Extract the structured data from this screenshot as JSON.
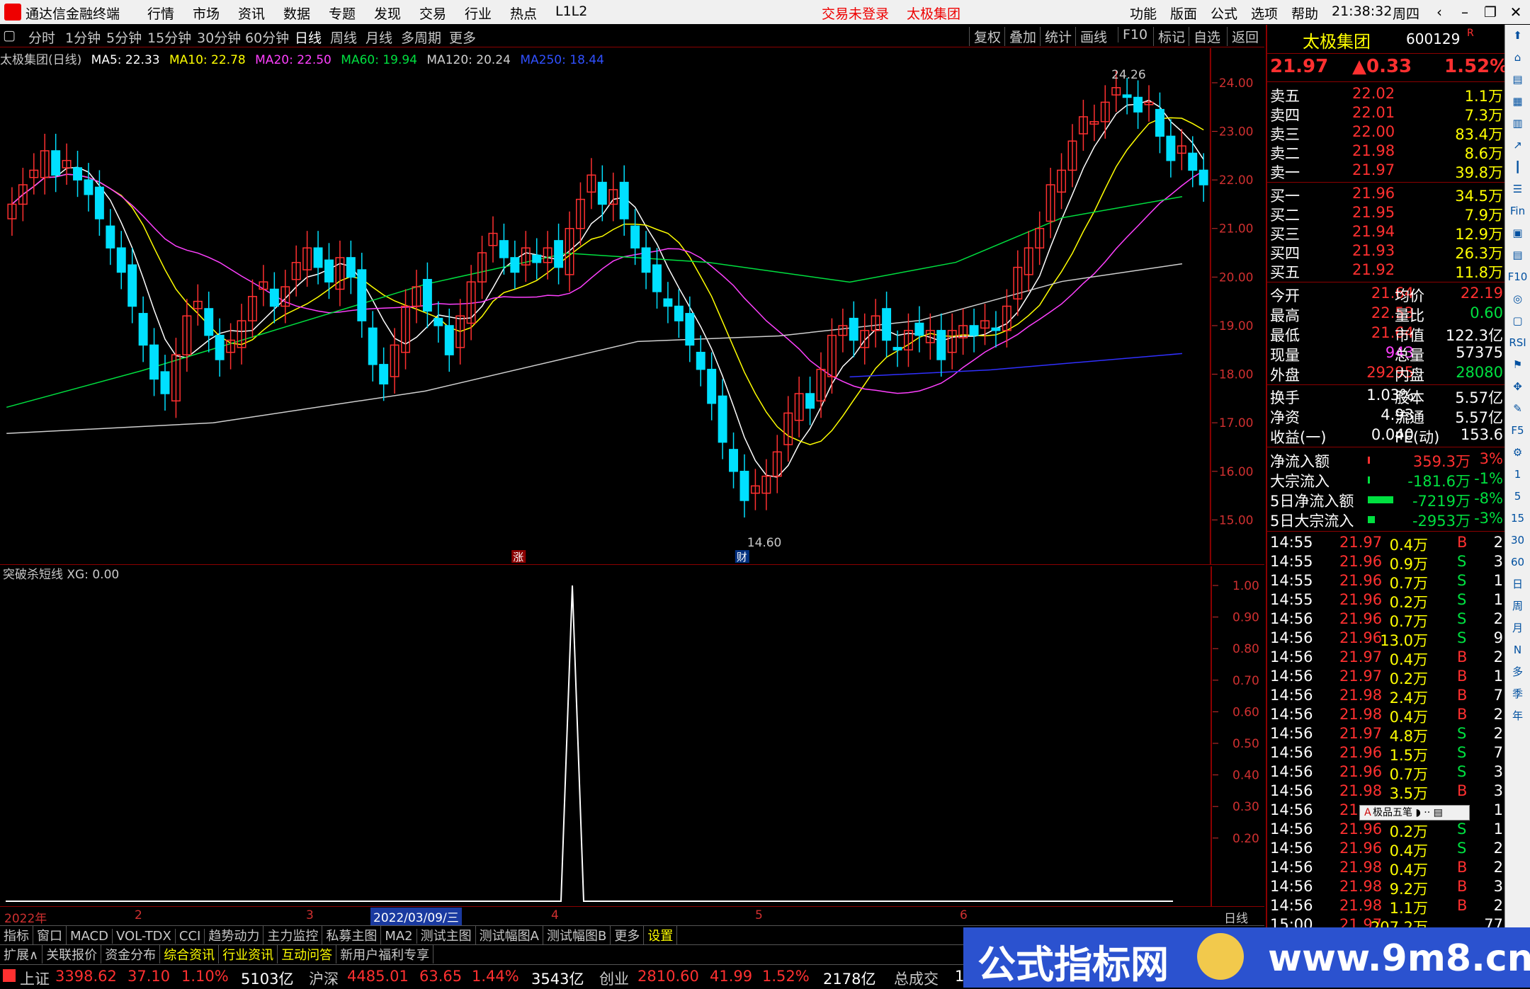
{
  "window": {
    "app_title": "通达信金融终端",
    "menus": [
      "行情",
      "市场",
      "资讯",
      "数据",
      "专题",
      "发现",
      "交易",
      "行业",
      "热点",
      "L1L2"
    ],
    "alert_login": "交易未登录",
    "alert_stock": "太极集团",
    "right_menus": [
      "功能",
      "版面",
      "公式",
      "选项",
      "帮助"
    ],
    "time": "21:38:32",
    "weekday": "周四"
  },
  "toolbar": {
    "timeframes": [
      "分时",
      "1分钟",
      "5分钟",
      "15分钟",
      "30分钟",
      "60分钟",
      "日线",
      "周线",
      "月线",
      "多周期",
      "更多"
    ],
    "buttons": [
      "复权",
      "叠加",
      "统计",
      "画线",
      "F10",
      "标记",
      "自选",
      "返回"
    ]
  },
  "legend": {
    "title": "太极集团(日线)",
    "ma5": "MA5: 22.33",
    "ma10": "MA10: 22.78",
    "ma20": "MA20: 22.50",
    "ma60": "MA60: 19.94",
    "ma120": "MA120: 20.24",
    "ma250": "MA250: 18.44"
  },
  "price_axis": [
    "24.00",
    "23.00",
    "22.00",
    "21.00",
    "20.00",
    "19.00",
    "18.00",
    "17.00",
    "16.00",
    "15.00"
  ],
  "high_label": "24.26",
  "low_label": "14.60",
  "marker_zhang": "涨",
  "marker_cai": "财",
  "indicator": {
    "title": "突破杀短线 XG: 0.00",
    "axis": [
      "1.00",
      "0.90",
      "0.80",
      "0.70",
      "0.60",
      "0.50",
      "0.40",
      "0.30",
      "0.20"
    ]
  },
  "dates": {
    "year": "2022年",
    "m2": "2",
    "m3": "3",
    "selected": "2022/03/09/三",
    "m4": "4",
    "m5": "5",
    "m6": "6",
    "period": "日线"
  },
  "tabs1": [
    "指标",
    "窗口",
    "MACD",
    "VOL-TDX",
    "CCI",
    "趋势动力",
    "主力监控",
    "私募主图",
    "MA2",
    "测试主图",
    "测试幅图A",
    "测试幅图B",
    "更多",
    "设置"
  ],
  "tabs2": [
    "扩展∧",
    "关联报价",
    "资金分布",
    "综合资讯",
    "行业资讯",
    "互动问答",
    "新用户福利专享"
  ],
  "stock": {
    "name": "太极集团",
    "code": "600129",
    "r": "R",
    "price": "21.97",
    "change": "▲0.33",
    "pct": "1.52%"
  },
  "asks": [
    {
      "label": "卖五",
      "price": "22.02",
      "vol": "1.1万"
    },
    {
      "label": "卖四",
      "price": "22.01",
      "vol": "7.3万"
    },
    {
      "label": "卖三",
      "price": "22.00",
      "vol": "83.4万"
    },
    {
      "label": "卖二",
      "price": "21.98",
      "vol": "8.6万"
    },
    {
      "label": "卖一",
      "price": "21.97",
      "vol": "39.8万"
    }
  ],
  "bids": [
    {
      "label": "买一",
      "price": "21.96",
      "vol": "34.5万"
    },
    {
      "label": "买二",
      "price": "21.95",
      "vol": "7.9万"
    },
    {
      "label": "买三",
      "price": "21.94",
      "vol": "12.9万"
    },
    {
      "label": "买四",
      "price": "21.93",
      "vol": "26.3万"
    },
    {
      "label": "买五",
      "price": "21.92",
      "vol": "11.8万"
    }
  ],
  "stats": [
    {
      "l1": "今开",
      "v1": "21.64",
      "l2": "均价",
      "v2": "22.19"
    },
    {
      "l1": "最高",
      "v1": "22.53",
      "l2": "量比",
      "v2": "0.60"
    },
    {
      "l1": "最低",
      "v1": "21.64",
      "l2": "市值",
      "v2": "122.3亿"
    },
    {
      "l1": "现量",
      "v1": "943",
      "l2": "总量",
      "v2": "57375"
    },
    {
      "l1": "外盘",
      "v1": "29295",
      "l2": "内盘",
      "v2": "28080"
    },
    {
      "l1": "换手",
      "v1": "1.03%",
      "l2": "股本",
      "v2": "5.57亿"
    },
    {
      "l1": "净资",
      "v1": "4.93",
      "l2": "流通",
      "v2": "5.57亿"
    },
    {
      "l1": "收益(一)",
      "v1": "0.040",
      "l2": "PE(动)",
      "v2": "153.6"
    }
  ],
  "flows": [
    {
      "label": "净流入额",
      "val": "359.3万",
      "pct": "3%"
    },
    {
      "label": "大宗流入",
      "val": "-181.6万",
      "pct": "-1%"
    },
    {
      "label": "5日净流入额",
      "val": "-7219万",
      "pct": "-8%"
    },
    {
      "label": "5日大宗流入",
      "val": "-2953万",
      "pct": "-3%"
    }
  ],
  "ticks": [
    {
      "t": "14:55",
      "p": "21.97",
      "v": "0.4万",
      "bs": "B",
      "n": "2"
    },
    {
      "t": "14:55",
      "p": "21.96",
      "v": "0.9万",
      "bs": "S",
      "n": "3"
    },
    {
      "t": "14:55",
      "p": "21.96",
      "v": "0.7万",
      "bs": "S",
      "n": "1"
    },
    {
      "t": "14:55",
      "p": "21.96",
      "v": "0.2万",
      "bs": "S",
      "n": "1"
    },
    {
      "t": "14:56",
      "p": "21.96",
      "v": "0.7万",
      "bs": "S",
      "n": "2"
    },
    {
      "t": "14:56",
      "p": "21.96",
      "v": "13.0万",
      "bs": "S",
      "n": "9"
    },
    {
      "t": "14:56",
      "p": "21.97",
      "v": "0.4万",
      "bs": "B",
      "n": "2"
    },
    {
      "t": "14:56",
      "p": "21.97",
      "v": "0.2万",
      "bs": "B",
      "n": "1"
    },
    {
      "t": "14:56",
      "p": "21.98",
      "v": "2.4万",
      "bs": "B",
      "n": "7"
    },
    {
      "t": "14:56",
      "p": "21.98",
      "v": "0.4万",
      "bs": "B",
      "n": "2"
    },
    {
      "t": "14:56",
      "p": "21.97",
      "v": "4.8万",
      "bs": "S",
      "n": "2"
    },
    {
      "t": "14:56",
      "p": "21.96",
      "v": "1.5万",
      "bs": "S",
      "n": "7"
    },
    {
      "t": "14:56",
      "p": "21.96",
      "v": "0.7万",
      "bs": "S",
      "n": "3"
    },
    {
      "t": "14:56",
      "p": "21.98",
      "v": "3.5万",
      "bs": "B",
      "n": "3"
    },
    {
      "t": "14:56",
      "p": "21",
      "v": "",
      "bs": "",
      "n": "1"
    },
    {
      "t": "14:56",
      "p": "21.96",
      "v": "0.2万",
      "bs": "S",
      "n": "1"
    },
    {
      "t": "14:56",
      "p": "21.96",
      "v": "0.4万",
      "bs": "S",
      "n": "2"
    },
    {
      "t": "14:56",
      "p": "21.98",
      "v": "0.4万",
      "bs": "B",
      "n": "2"
    },
    {
      "t": "14:56",
      "p": "21.98",
      "v": "9.2万",
      "bs": "B",
      "n": "3"
    },
    {
      "t": "14:56",
      "p": "21.98",
      "v": "1.1万",
      "bs": "B",
      "n": "2"
    },
    {
      "t": "15:00",
      "p": "21.97",
      "v": "207.2万",
      "bs": "",
      "n": "77"
    }
  ],
  "ime": "极品五笔",
  "status": {
    "sh_label": "上证",
    "sh_val": "3398.62",
    "sh_chg": "37.10",
    "sh_pct": "1.10%",
    "sh_amt": "5103亿",
    "hs_label": "沪深",
    "hs_val": "4485.01",
    "hs_chg": "63.65",
    "hs_pct": "1.44%",
    "hs_amt": "3543亿",
    "cy_label": "创业",
    "cy_val": "2810.60",
    "cy_chg": "41.99",
    "cy_pct": "1.52%",
    "cy_amt": "2178亿",
    "total": "总成交",
    "total_v": "1"
  },
  "watermark": {
    "text": "公式指标网",
    "url": "www.9m8.cn"
  },
  "sidebar": [
    "1",
    "5",
    "15",
    "30",
    "60",
    "日",
    "周",
    "月",
    "N",
    "多",
    "季",
    "年"
  ],
  "colors": {
    "up": "#ff3030",
    "down": "#00e0ff",
    "ma5": "#ffffff",
    "ma10": "#ffff00",
    "ma20": "#ff40ff",
    "ma60": "#00e040",
    "ma120": "#d0d0d0",
    "ma250": "#3030ff"
  }
}
